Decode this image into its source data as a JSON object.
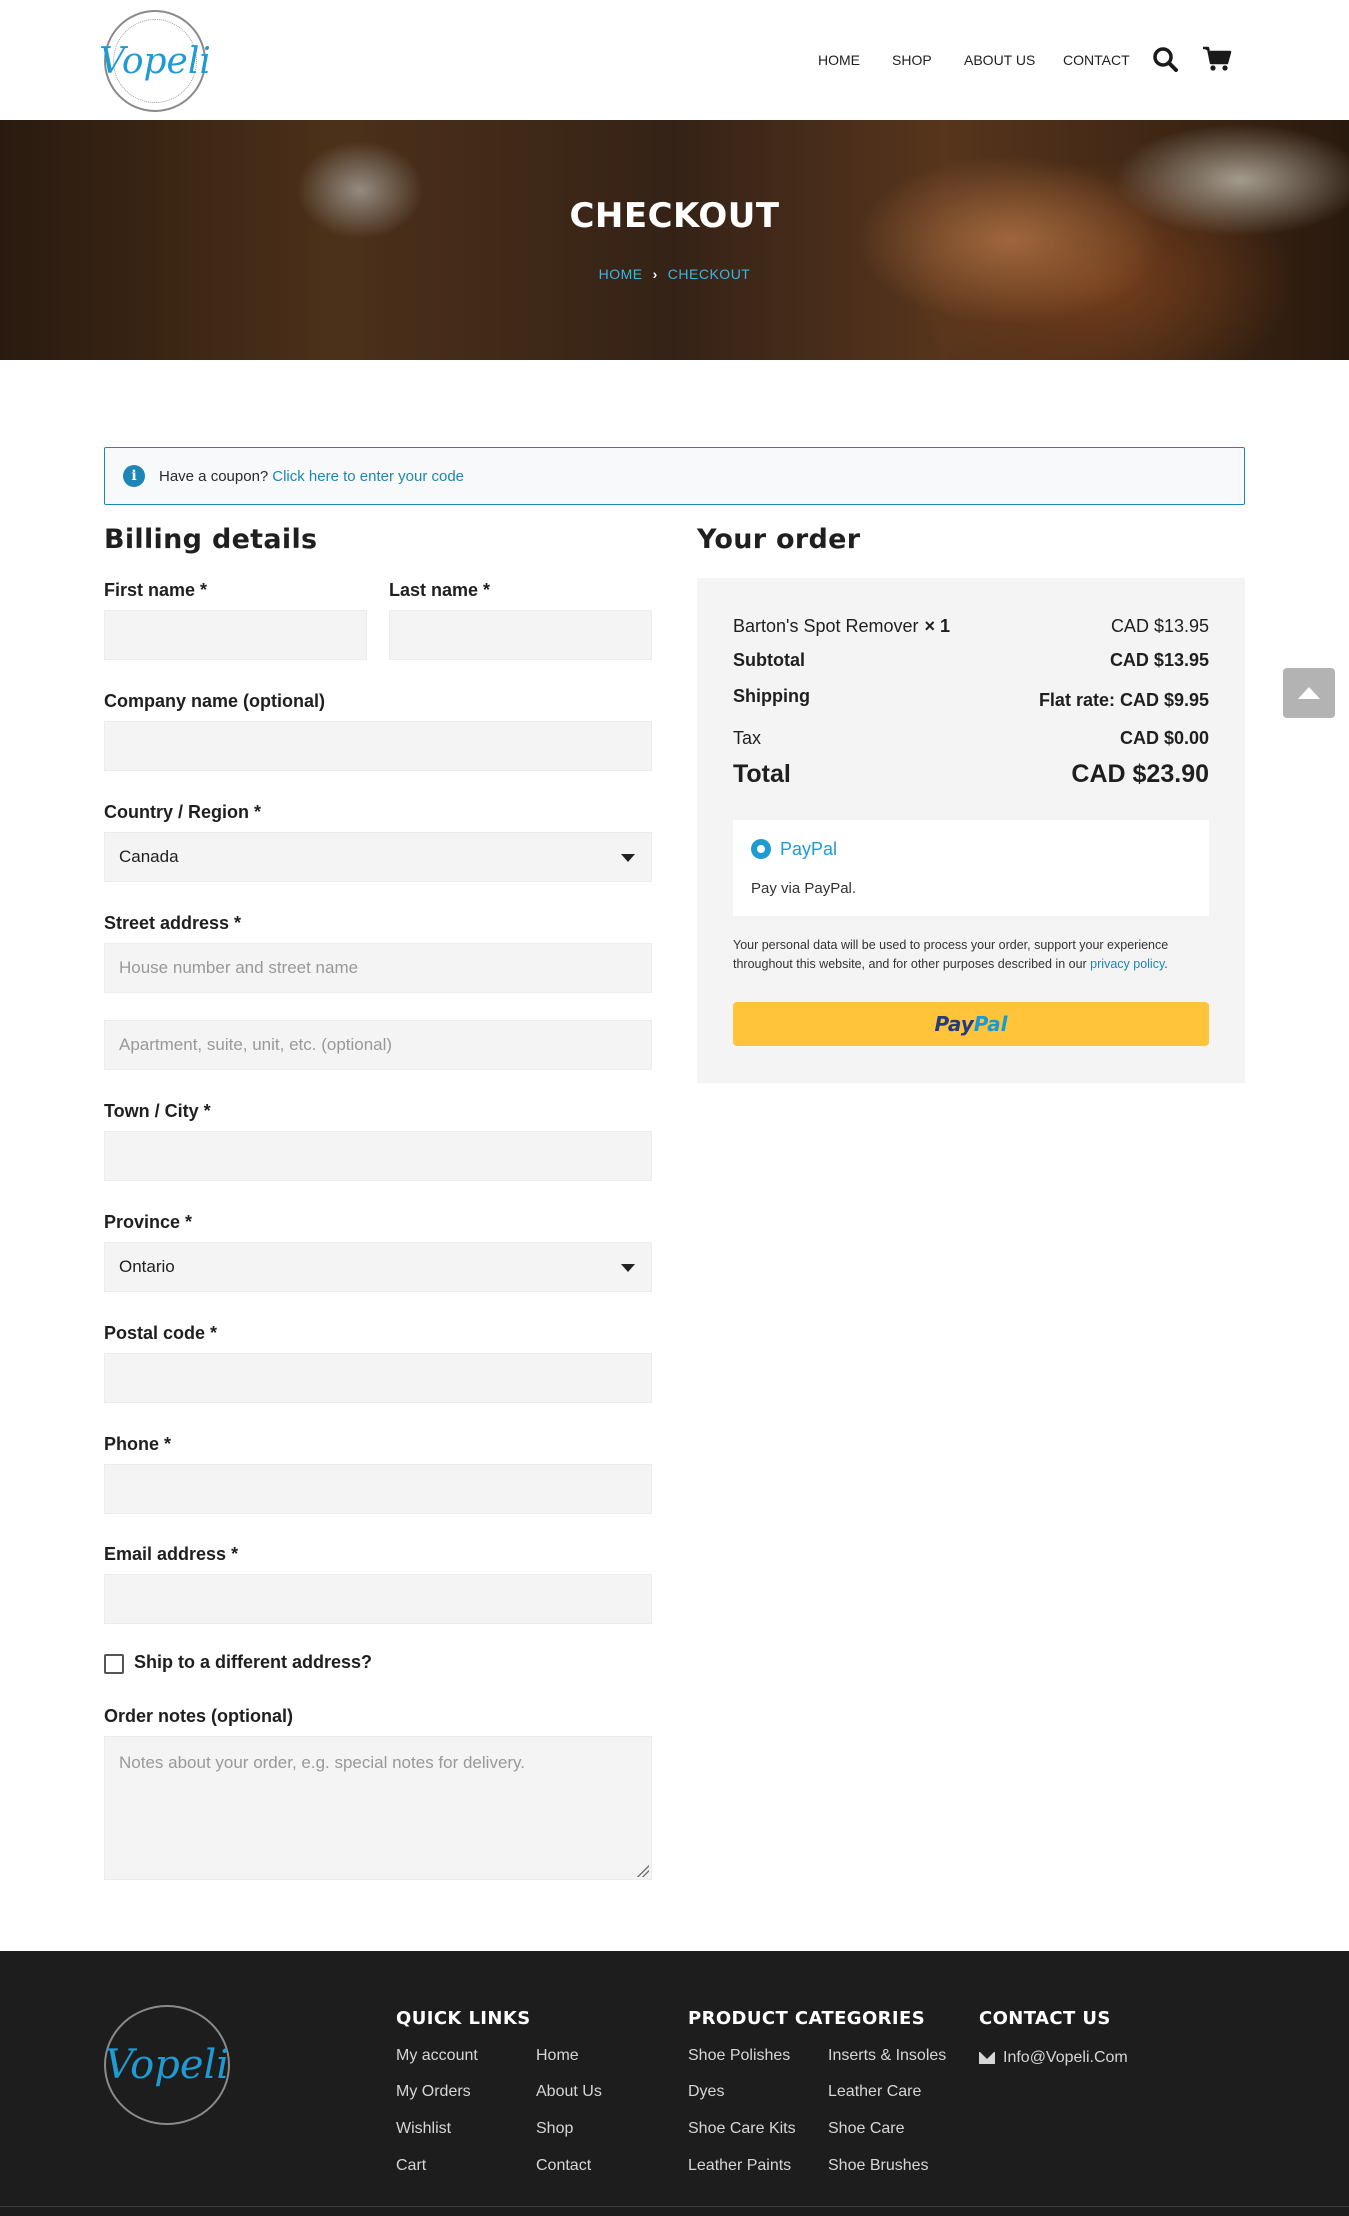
{
  "brand": {
    "logo_text": "Vopeli",
    "accent": "#1e9bd3"
  },
  "nav": {
    "home": "HOME",
    "shop": "SHOP",
    "about": "ABOUT US",
    "contact": "CONTACT"
  },
  "hero": {
    "title": "CHECKOUT",
    "crumb_home": "HOME",
    "crumb_current": "CHECKOUT"
  },
  "coupon": {
    "text": "Have a coupon?",
    "link": "Click here to enter your code"
  },
  "billing": {
    "heading": "Billing details",
    "first_name": "First name *",
    "last_name": "Last name *",
    "company": "Company name (optional)",
    "country_label": "Country / Region *",
    "country_value": "Canada",
    "street_label": "Street address *",
    "street_placeholder": "House number and street name",
    "street2_placeholder": "Apartment, suite, unit, etc. (optional)",
    "city": "Town / City *",
    "province_label": "Province *",
    "province_value": "Ontario",
    "postal": "Postal code *",
    "phone": "Phone *",
    "email": "Email address *",
    "ship_different": "Ship to a different address?",
    "notes_label": "Order notes (optional)",
    "notes_placeholder": "Notes about your order, e.g. special notes for delivery."
  },
  "order": {
    "heading": "Your order",
    "item_name": "Barton's Spot Remover",
    "item_qty": "× 1",
    "item_price": "CAD $13.95",
    "subtotal_label": "Subtotal",
    "subtotal_value": "CAD $13.95",
    "shipping_label": "Shipping",
    "shipping_value": "Flat rate: CAD $9.95",
    "tax_label": "Tax",
    "tax_value": "CAD $0.00",
    "total_label": "Total",
    "total_value": "CAD $23.90",
    "payment_name": "PayPal",
    "payment_desc": "Pay via PayPal.",
    "privacy_text": "Your personal data will be used to process your order, support your experience throughout this website, and for other purposes described in our",
    "privacy_link": "privacy policy",
    "paypal_pay": "Pay",
    "paypal_pal": "Pal"
  },
  "footer": {
    "quick_links_heading": "QUICK LINKS",
    "quick_links_col1": [
      "My account",
      "My Orders",
      "Wishlist",
      "Cart"
    ],
    "quick_links_col2": [
      "Home",
      "About Us",
      "Shop",
      "Contact"
    ],
    "categories_heading": "PRODUCT CATEGORIES",
    "categories_col1": [
      "Shoe Polishes",
      "Dyes",
      "Shoe Care Kits",
      "Leather Paints"
    ],
    "categories_col2": [
      "Inserts & Insoles",
      "Leather Care",
      "Shoe Care",
      "Shoe Brushes"
    ],
    "contact_heading": "CONTACT US",
    "email": "Info@Vopeli.Com"
  }
}
